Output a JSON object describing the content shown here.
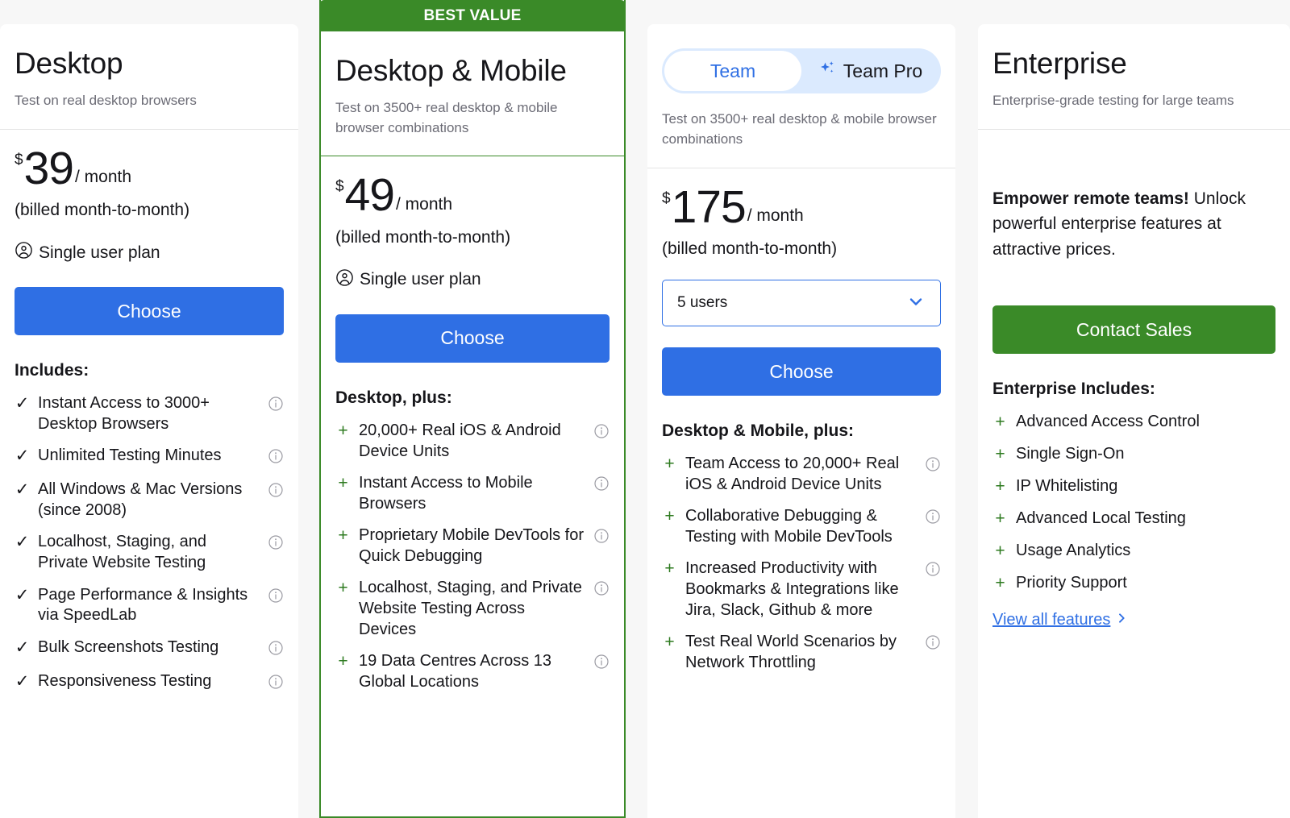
{
  "theme": {
    "blue": "#2f6fe4",
    "green": "#3a8a28",
    "plus_green": "#2d7a1f",
    "page_bg": "#f7f7f7"
  },
  "badges": {
    "best_value": "BEST VALUE"
  },
  "plans": [
    {
      "id": "desktop",
      "title": "Desktop",
      "subtitle": "Test on real desktop browsers",
      "currency": "$",
      "amount": "39",
      "per": "/ month",
      "billed": "(billed month-to-month)",
      "user_note": "Single user plan",
      "cta": "Choose",
      "features_heading": "Includes:",
      "features": [
        "Instant Access to 3000+ Desktop Browsers",
        "Unlimited Testing Minutes",
        "All Windows & Mac Versions (since 2008)",
        "Localhost, Staging, and Private Website Testing",
        "Page Performance & Insights via SpeedLab",
        "Bulk Screenshots Testing",
        "Responsiveness Testing"
      ]
    },
    {
      "id": "desktop-mobile",
      "title": "Desktop & Mobile",
      "subtitle": "Test on 3500+ real desktop & mobile browser combinations",
      "currency": "$",
      "amount": "49",
      "per": "/ month",
      "billed": "(billed month-to-month)",
      "user_note": "Single user plan",
      "cta": "Choose",
      "features_heading": "Desktop, plus:",
      "features": [
        "20,000+ Real iOS & Android Device Units",
        "Instant Access to Mobile Browsers",
        "Proprietary Mobile DevTools for Quick Debugging",
        "Localhost, Staging, and Private Website Testing Across Devices",
        "19 Data Centres Across 13 Global Locations"
      ]
    },
    {
      "id": "team",
      "title": "Team",
      "subtitle": "Test on 3500+ real desktop & mobile browser combinations",
      "toggle": {
        "option_a": "Team",
        "option_b": "Team Pro",
        "selected": "Team"
      },
      "currency": "$",
      "amount": "175",
      "per": "/ month",
      "billed": "(billed month-to-month)",
      "seats_value": "5 users",
      "cta": "Choose",
      "features_heading": "Desktop & Mobile, plus:",
      "features": [
        "Team Access to 20,000+ Real iOS & Android Device Units",
        "Collaborative Debugging & Testing with Mobile DevTools",
        "Increased Productivity with Bookmarks & Integrations like Jira, Slack, Github & more",
        "Test Real World Scenarios by Network Throttling"
      ]
    },
    {
      "id": "enterprise",
      "title": "Enterprise",
      "subtitle": "Enterprise-grade testing for large teams",
      "pitch_bold": "Empower remote teams!",
      "pitch_rest": "Unlock powerful enterprise features at attractive prices.",
      "cta": "Contact Sales",
      "features_heading": "Enterprise Includes:",
      "features": [
        "Advanced Access Control",
        "Single Sign-On",
        "IP Whitelisting",
        "Advanced Local Testing",
        "Usage Analytics",
        "Priority Support"
      ],
      "view_all": "View all features"
    }
  ],
  "icons": {
    "info": "info-icon",
    "single_user": "user-circle-icon",
    "chevron_down": "chevron-down-icon",
    "chevron_right": "chevron-right-icon",
    "sparkle": "sparkle-icon",
    "check": "check-icon",
    "plus": "plus-icon"
  }
}
